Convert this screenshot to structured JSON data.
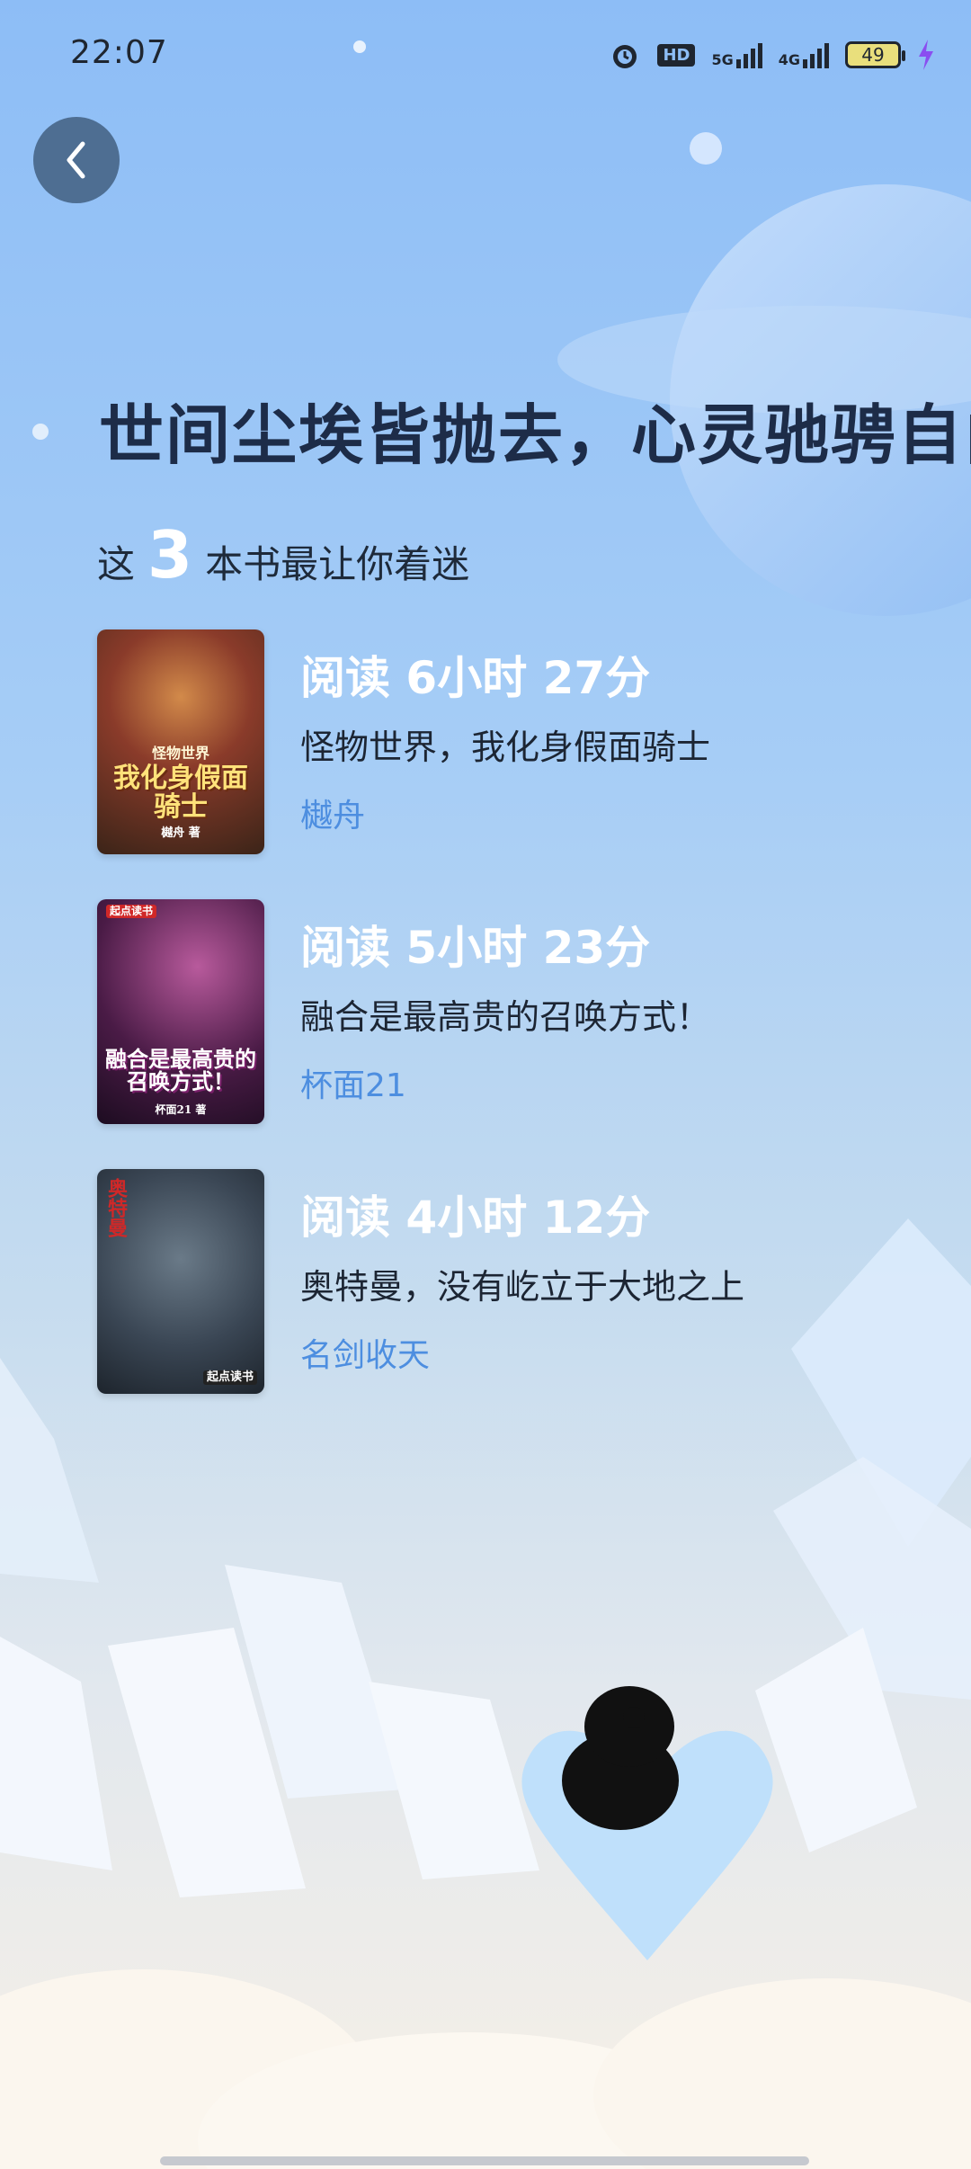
{
  "status_bar": {
    "time": "22:07",
    "battery": "49",
    "network_1": "5G",
    "network_2": "4G",
    "hd_badge": "HD"
  },
  "back_button_icon": "chevron-left-icon",
  "headline": "世间尘埃皆抛去，心灵驰骋自由间",
  "summary": {
    "prefix": "这",
    "count": "3",
    "suffix": "本书最让你着迷"
  },
  "books": [
    {
      "read_time": "阅读 6小时 27分",
      "title": "怪物世界，我化身假面骑士",
      "author": "樾舟",
      "cover_text_top": "怪物世界",
      "cover_text_main": "我化身假面骑士",
      "cover_text_small": "樾舟 著"
    },
    {
      "read_time": "阅读 5小时 23分",
      "title": "融合是最高贵的召唤方式！",
      "author": "杯面21",
      "cover_badge": "起点读书",
      "cover_text_main": "融合是最高贵的召唤方式！",
      "cover_text_small": "杯面21 著"
    },
    {
      "read_time": "阅读 4小时 12分",
      "title": "奥特曼，没有屹立于大地之上",
      "author": "名剑收天",
      "cover_text_main": "奥特曼",
      "cover_badge": "起点读书"
    }
  ],
  "colors": {
    "accent_author": "#4d8ee0",
    "back_button": "#4e6e92",
    "headline": "#1d2c48"
  }
}
